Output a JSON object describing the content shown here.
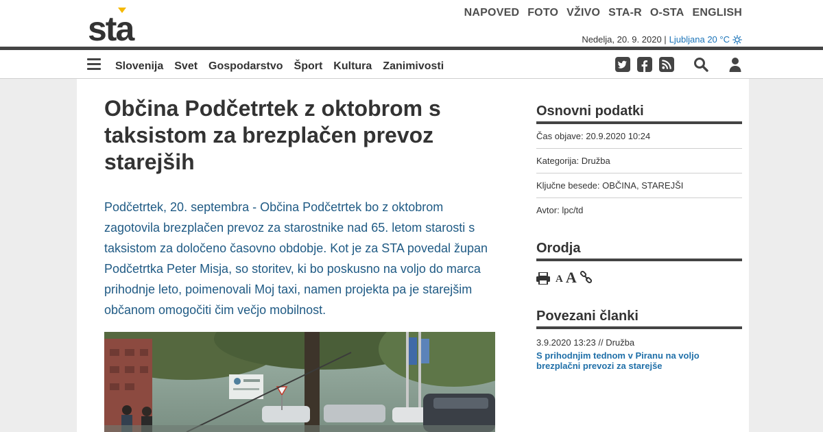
{
  "header": {
    "logo_text": "sta",
    "top_nav": [
      "NAPOVED",
      "FOTO",
      "VŽIVO",
      "STA-R",
      "O-STA",
      "ENGLISH"
    ],
    "date": "Nedelja, 20. 9. 2020 |",
    "weather": "Ljubljana 20 °C",
    "weather_icon": "sun-icon"
  },
  "main_nav": {
    "items": [
      "Slovenija",
      "Svet",
      "Gospodarstvo",
      "Šport",
      "Kultura",
      "Zanimivosti"
    ],
    "icons": [
      "twitter-icon",
      "facebook-icon",
      "rss-icon",
      "search-icon",
      "user-icon"
    ]
  },
  "article": {
    "title": "Občina Podčetrtek z oktobrom s taksistom za brezplačen prevoz starejših",
    "lead": "Podčetrtek, 20. septembra - Občina Podčetrtek bo z oktobrom zagotovila brezplačen prevoz za starostnike nad 65. letom starosti s taksistom za določeno časovno obdobje. Kot je za STA povedal župan Podčetrtka Peter Misja, so storitev, ki bo poskusno na voljo do marca prihodnje leto, poimenovali Moj taxi, namen projekta pa je starejšim občanom omogočiti čim večjo mobilnost."
  },
  "sidebar": {
    "basic_title": "Osnovni podatki",
    "published": "Čas objave: 20.9.2020 10:24",
    "category": "Kategorija: Družba",
    "keywords": "Ključne besede: OBČINA, STAREJŠI",
    "author": "Avtor: lpc/td",
    "tools_title": "Orodja",
    "font_small": "A",
    "font_big": "A",
    "related_title": "Povezani članki",
    "related": [
      {
        "meta": "3.9.2020 13:23 // Družba",
        "title": "S prihodnjim tednom v Piranu na voljo brezplačni prevozi za starejše"
      }
    ]
  },
  "colors": {
    "accent_link": "#1a73b8",
    "lead_text": "#1f5a84",
    "logo_accent": "#f5b800",
    "rule": "#444444"
  }
}
